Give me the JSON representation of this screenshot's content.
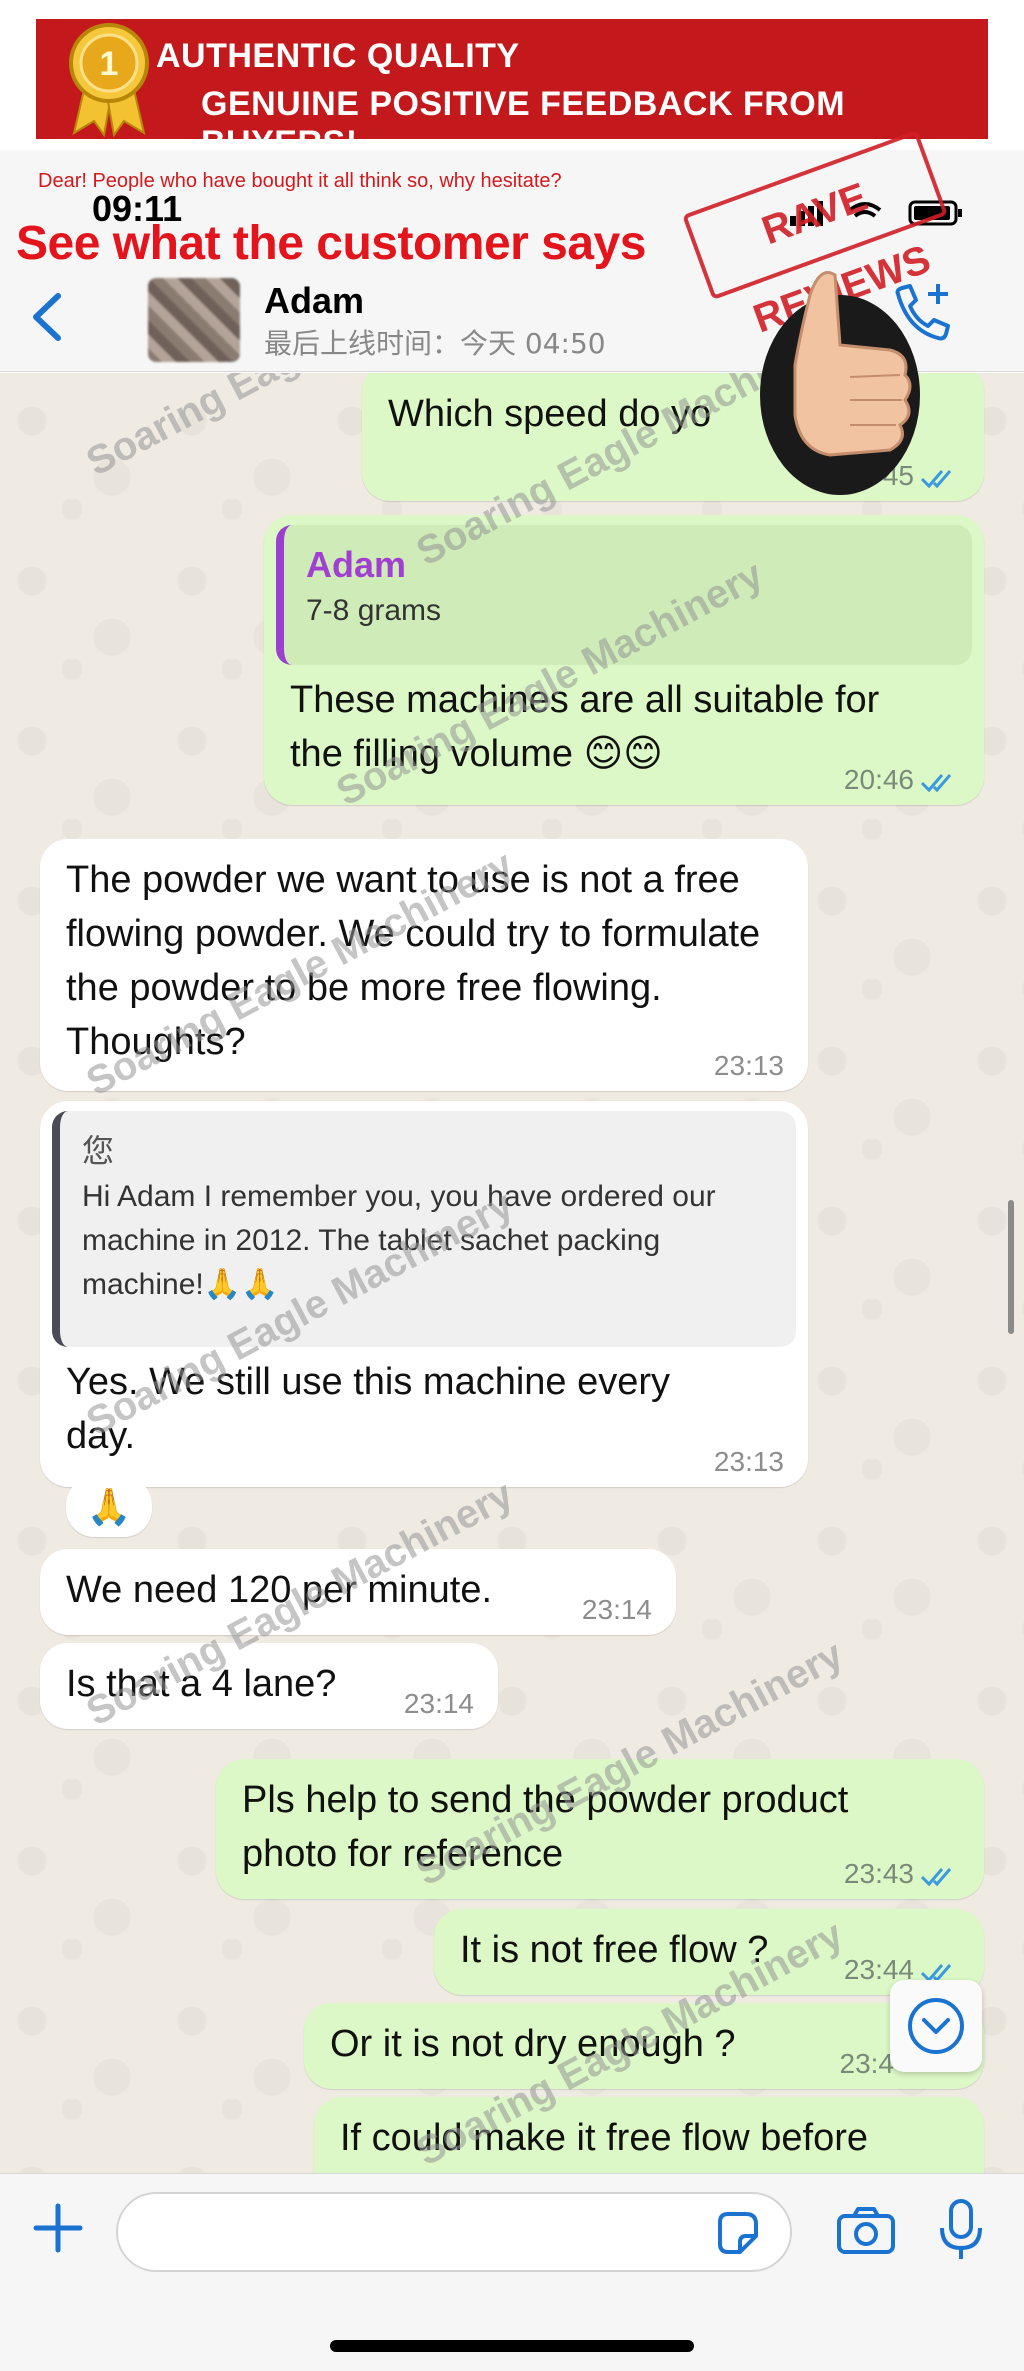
{
  "banner": {
    "line1": "AUTHENTIC QUALITY",
    "line2": "GENUINE POSITIVE FEEDBACK FROM BUYERS!",
    "medal_number": "1"
  },
  "promo": {
    "small_text": "Dear! People who have bought it all think so, why hesitate?",
    "big_text": "See what the customer says",
    "stamp_text": "RAVE REVIEWS"
  },
  "status_bar": {
    "time": "09:11"
  },
  "contact": {
    "name": "Adam",
    "last_seen": "最后上线时间：今天 04:50"
  },
  "watermark_text": "Soaring Eagle Machinery",
  "messages": [
    {
      "id": "m1",
      "direction": "out",
      "text": "Which speed do yo",
      "time": "45",
      "read": true
    },
    {
      "id": "m2",
      "direction": "out",
      "quote_author": "Adam",
      "quote_text": "7-8 grams",
      "text": "These machines are all suitable for the filling volume 😊😊",
      "time": "20:46",
      "read": true
    },
    {
      "id": "m3",
      "direction": "in",
      "text": "The powder we want to use is not a free flowing powder. We could try to formulate the powder to be more free flowing. Thoughts?",
      "time": "23:13"
    },
    {
      "id": "m4",
      "direction": "in",
      "quote_author": "您",
      "quote_text": "Hi Adam I remember you, you have ordered our machine in 2012. The tablet sachet packing machine!🙏🙏",
      "text": "Yes. We still use this machine every day.",
      "time": "23:13"
    },
    {
      "id": "m5",
      "direction": "in",
      "text": "🙏"
    },
    {
      "id": "m6",
      "direction": "in",
      "text": "We need 120 per minute.",
      "time": "23:14"
    },
    {
      "id": "m7",
      "direction": "in",
      "text": "Is that a 4 lane?",
      "time": "23:14"
    },
    {
      "id": "m8",
      "direction": "out",
      "text": "Pls help to send the powder product photo for reference",
      "time": "23:43",
      "read": true
    },
    {
      "id": "m9",
      "direction": "out",
      "text": "It is not free flow ?",
      "time": "23:44",
      "read": true
    },
    {
      "id": "m10",
      "direction": "out",
      "text": "Or it is not dry enough ?",
      "time": "23:4"
    },
    {
      "id": "m11",
      "direction": "out",
      "text": "If could make it free flow before"
    }
  ],
  "input": {
    "placeholder": "",
    "value": ""
  },
  "colors": {
    "banner_red": "#c4191c",
    "outgoing_bubble": "#dcf8c6",
    "incoming_bubble": "#ffffff",
    "chat_background": "#efeae2",
    "accent_blue": "#1a73d1",
    "quote_author_purple": "#a23fd3"
  },
  "icons": [
    "medal-icon",
    "back-chevron-icon",
    "call-plus-icon",
    "thumbs-up-icon",
    "scroll-down-chevron-icon",
    "plus-icon",
    "sticker-icon",
    "camera-icon",
    "mic-icon",
    "double-check-icon",
    "signal-icon",
    "wifi-icon",
    "battery-icon"
  ]
}
